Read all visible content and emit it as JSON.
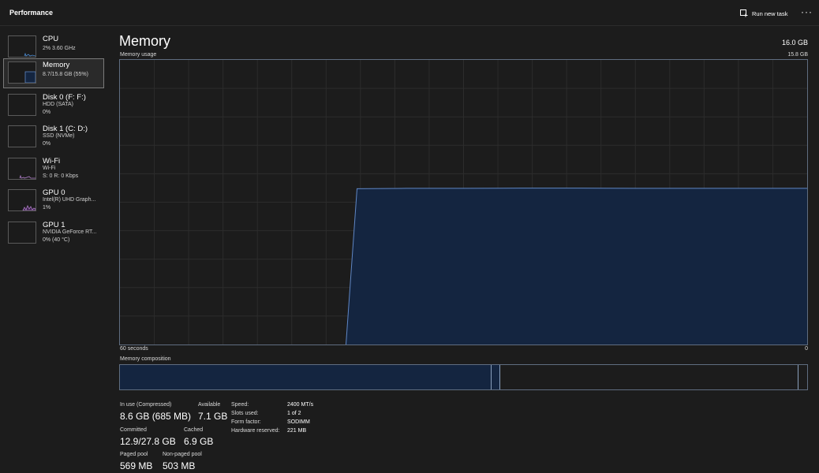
{
  "header": {
    "title": "Performance",
    "run_task_label": "Run new task",
    "more_label": "···"
  },
  "sidebar": {
    "items": [
      {
        "name": "CPU",
        "sub1": "2% 3.60 GHz",
        "sub2": ""
      },
      {
        "name": "Memory",
        "sub1": "8.7/15.8 GB (55%)",
        "sub2": ""
      },
      {
        "name": "Disk 0 (F: F:)",
        "sub1": "HDD (SATA)",
        "sub2": "0%"
      },
      {
        "name": "Disk 1 (C: D:)",
        "sub1": "SSD (NVMe)",
        "sub2": "0%"
      },
      {
        "name": "Wi-Fi",
        "sub1": "Wi-Fi",
        "sub2": "S: 0 R: 0 Kbps"
      },
      {
        "name": "GPU 0",
        "sub1": "Intel(R) UHD Graph...",
        "sub2": "1%"
      },
      {
        "name": "GPU 1",
        "sub1": "NVIDIA GeForce RT...",
        "sub2": "0% (40 °C)"
      }
    ]
  },
  "main": {
    "title": "Memory",
    "total": "16.0 GB",
    "usage_label": "Memory usage",
    "usage_max": "15.8 GB",
    "axis_left": "60 seconds",
    "axis_right": "0",
    "composition_label": "Memory composition"
  },
  "stats": {
    "in_use_label": "In use (Compressed)",
    "in_use_value": "8.6 GB (685 MB)",
    "available_label": "Available",
    "available_value": "7.1 GB",
    "committed_label": "Committed",
    "committed_value": "12.9/27.8 GB",
    "cached_label": "Cached",
    "cached_value": "6.9 GB",
    "paged_label": "Paged pool",
    "paged_value": "569 MB",
    "nonpaged_label": "Non-paged pool",
    "nonpaged_value": "503 MB",
    "speed_label": "Speed:",
    "speed_value": "2400 MT/s",
    "slots_label": "Slots used:",
    "slots_value": "1 of 2",
    "form_label": "Form factor:",
    "form_value": "SODIMM",
    "reserved_label": "Hardware reserved:",
    "reserved_value": "221 MB"
  },
  "colors": {
    "accent_line": "#5f86c4",
    "fill": "#142540",
    "border": "#5f6d80"
  },
  "chart_data": {
    "type": "area",
    "x_label": "60 seconds",
    "x_right_label": "0",
    "ylim": [
      0,
      15.8
    ],
    "unit": "GB",
    "grid": true,
    "note_range_seconds": [
      60,
      0
    ],
    "series": [
      {
        "x": [
          60,
          40,
          39.3,
          35,
          30,
          25,
          20,
          15,
          10,
          5,
          0
        ],
        "values": [
          null,
          null,
          8.65,
          8.67,
          8.67,
          8.68,
          8.68,
          8.67,
          8.67,
          8.67,
          8.67
        ]
      }
    ],
    "composition_gb": {
      "in_use": 8.6,
      "modified": 0.2,
      "standby": 6.9,
      "free": 0.2
    }
  }
}
